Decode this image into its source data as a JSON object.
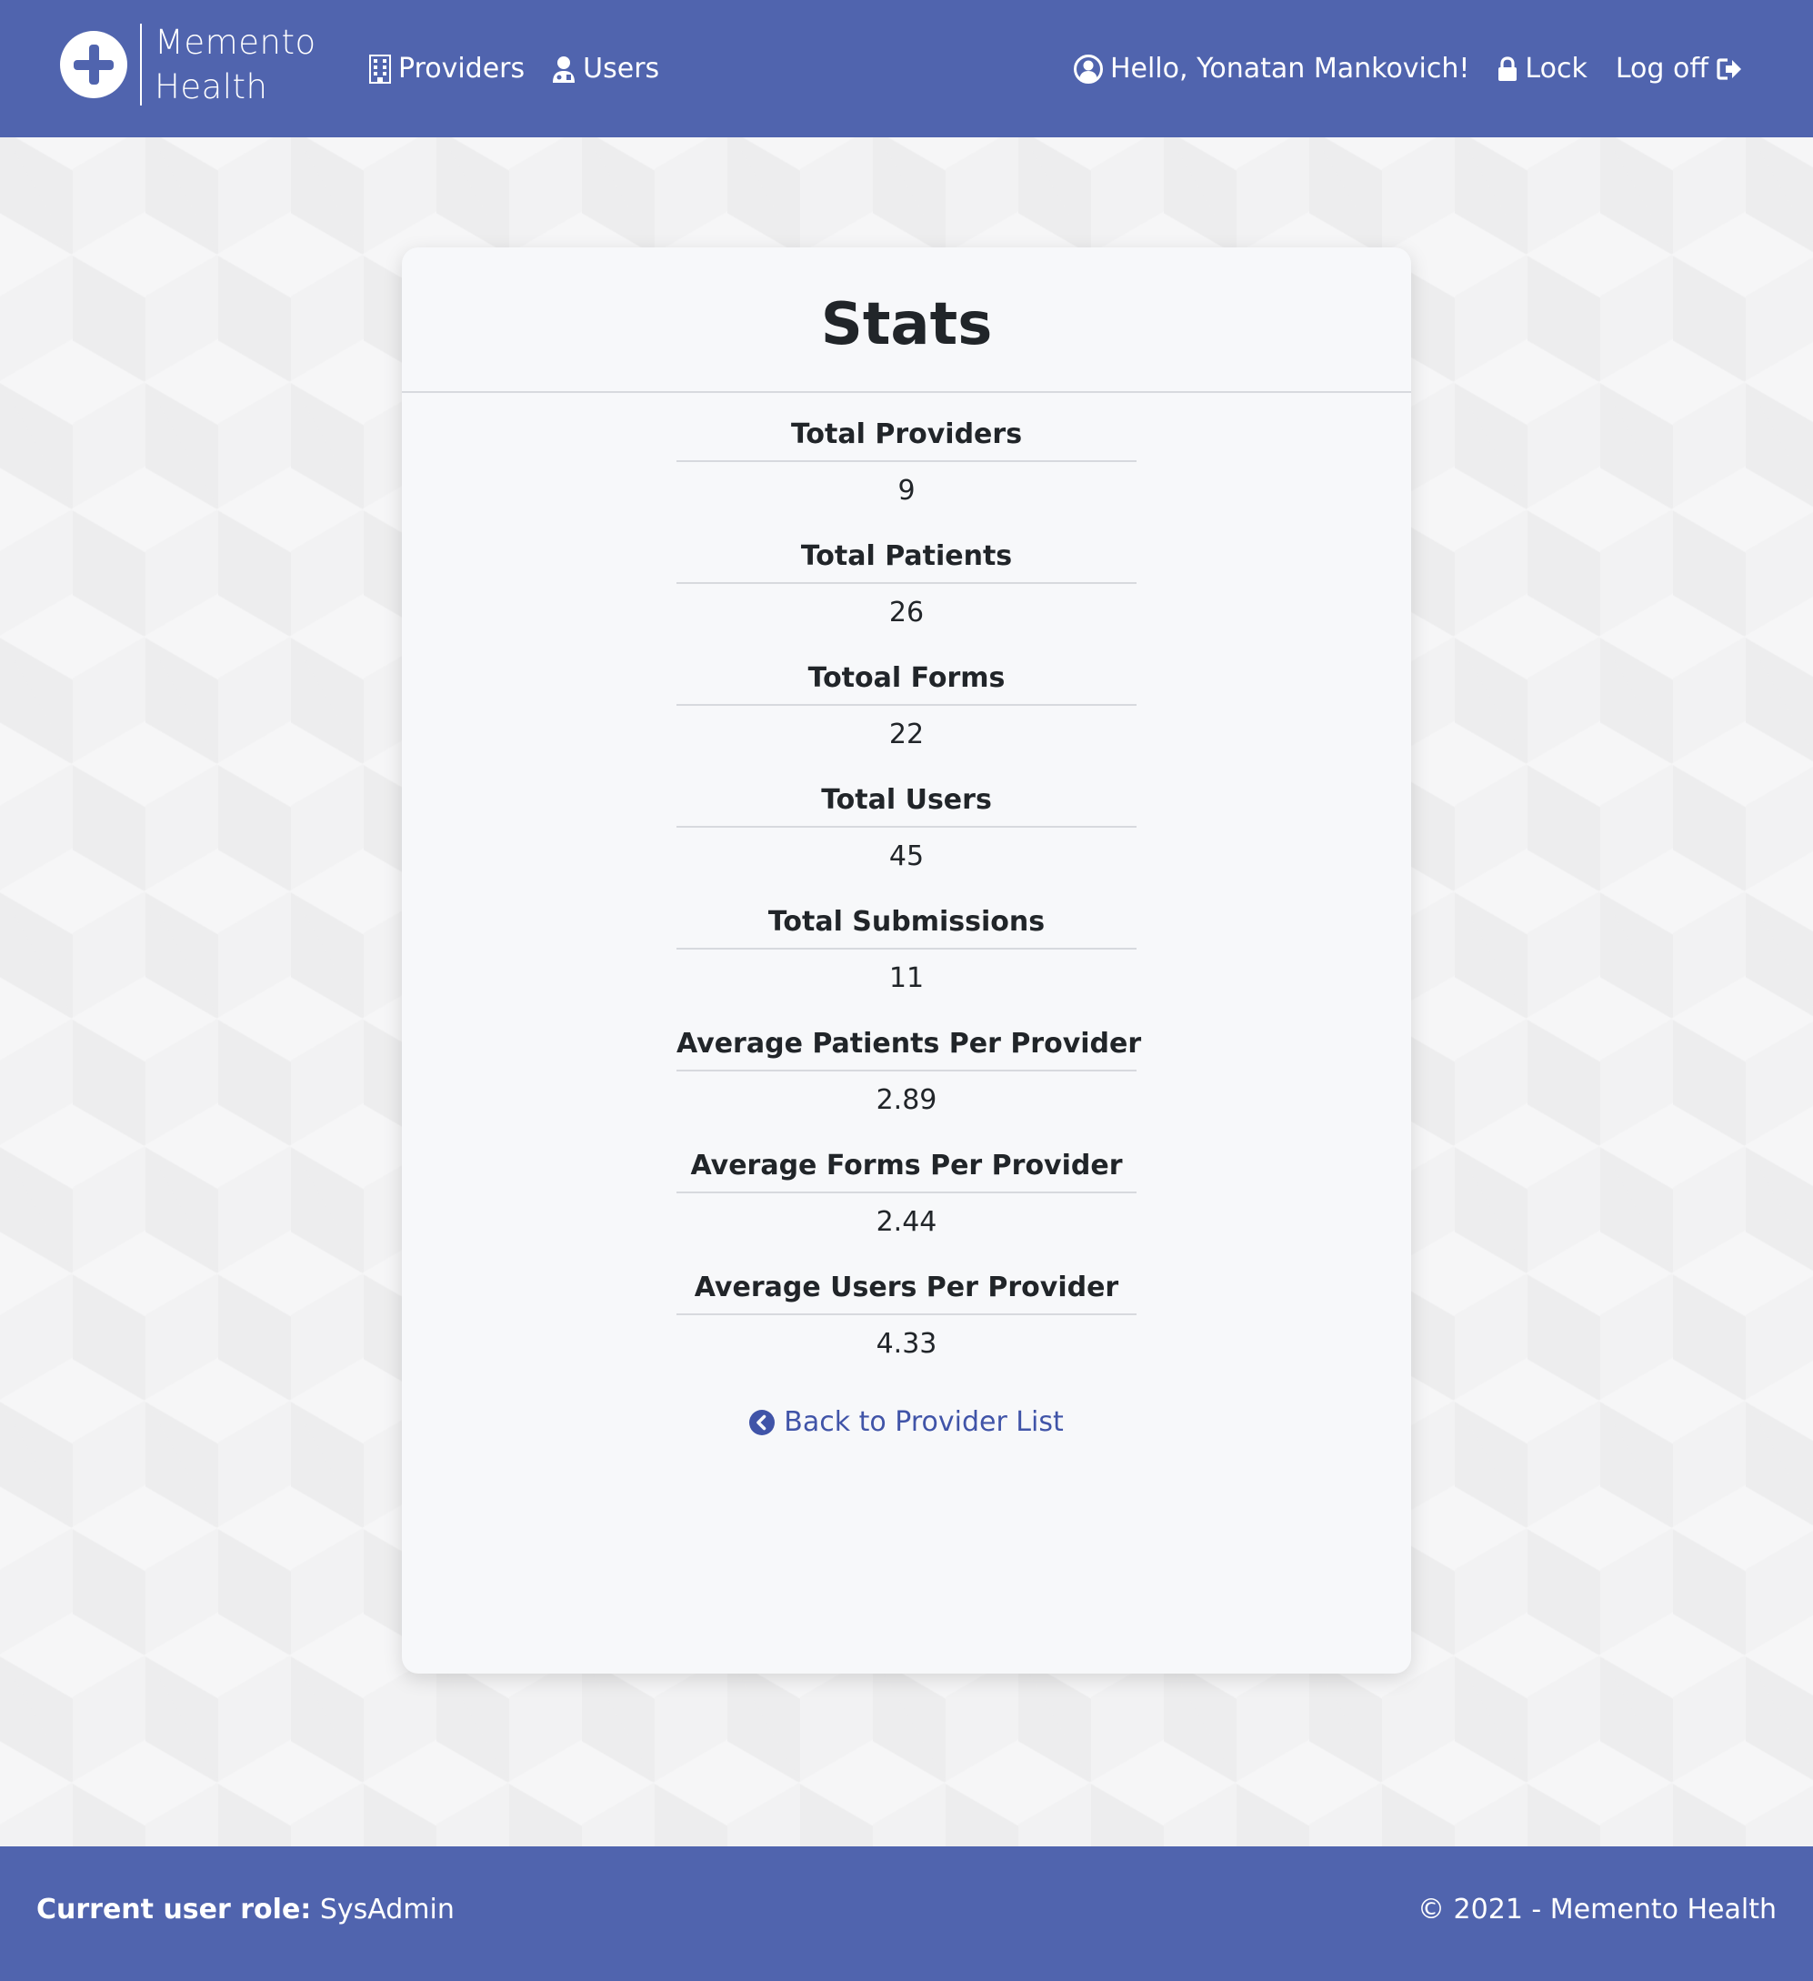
{
  "brand": {
    "line1": "Memento",
    "line2": "Health",
    "logo_icon": "medical-cross-icon"
  },
  "nav": {
    "providers_label": "Providers",
    "users_label": "Users",
    "greeting": "Hello, Yonatan Mankovich!",
    "lock_label": "Lock",
    "logoff_label": "Log off"
  },
  "page": {
    "title": "Stats"
  },
  "stats": [
    {
      "label": "Total Providers",
      "value": "9"
    },
    {
      "label": "Total Patients",
      "value": "26"
    },
    {
      "label": "Totoal Forms",
      "value": "22"
    },
    {
      "label": "Total Users",
      "value": "45"
    },
    {
      "label": "Total Submissions",
      "value": "11"
    },
    {
      "label": "Average Patients Per Provider",
      "value": "2.89"
    },
    {
      "label": "Average Forms Per Provider",
      "value": "2.44"
    },
    {
      "label": "Average Users Per Provider",
      "value": "4.33"
    }
  ],
  "back_link": {
    "label": "Back to Provider List"
  },
  "footer": {
    "role_label": "Current user role:",
    "role_value": "SysAdmin",
    "copyright": "© 2021 - Memento Health"
  },
  "colors": {
    "header_bg": "#5064ae",
    "link": "#4054a8",
    "card_bg": "#f7f8fa"
  }
}
